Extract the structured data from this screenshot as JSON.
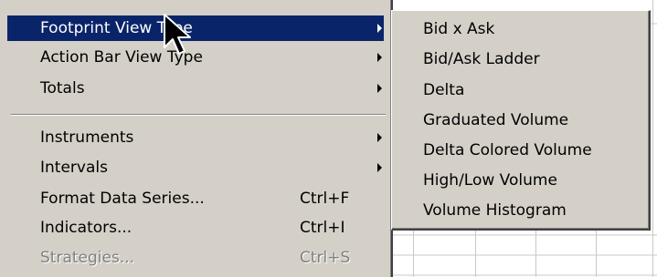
{
  "menu": {
    "items": [
      {
        "label": "Footprint View Type",
        "shortcut": "",
        "submenu": true,
        "highlighted": true,
        "disabled": false
      },
      {
        "label": "Action Bar View Type",
        "shortcut": "",
        "submenu": true,
        "highlighted": false,
        "disabled": false
      },
      {
        "label": "Totals",
        "shortcut": "",
        "submenu": true,
        "highlighted": false,
        "disabled": false
      },
      {
        "label": "Instruments",
        "shortcut": "",
        "submenu": true,
        "highlighted": false,
        "disabled": false
      },
      {
        "label": "Intervals",
        "shortcut": "",
        "submenu": true,
        "highlighted": false,
        "disabled": false
      },
      {
        "label": "Format Data Series...",
        "shortcut": "Ctrl+F",
        "submenu": false,
        "highlighted": false,
        "disabled": false
      },
      {
        "label": "Indicators...",
        "shortcut": "Ctrl+I",
        "submenu": false,
        "highlighted": false,
        "disabled": false
      },
      {
        "label": "Strategies...",
        "shortcut": "Ctrl+S",
        "submenu": false,
        "highlighted": false,
        "disabled": true
      }
    ]
  },
  "submenu": {
    "items": [
      {
        "label": "Bid x Ask"
      },
      {
        "label": "Bid/Ask Ladder"
      },
      {
        "label": "Delta"
      },
      {
        "label": "Graduated Volume"
      },
      {
        "label": "Delta Colored Volume"
      },
      {
        "label": "High/Low Volume"
      },
      {
        "label": "Volume Histogram"
      }
    ]
  },
  "colors": {
    "menu_face": "#d4d0c8",
    "highlight": "#0a246a",
    "disabled_text": "#808080",
    "grid_line": "#c0c0c0"
  },
  "cursor": {
    "icon": "mouse-pointer-icon"
  }
}
